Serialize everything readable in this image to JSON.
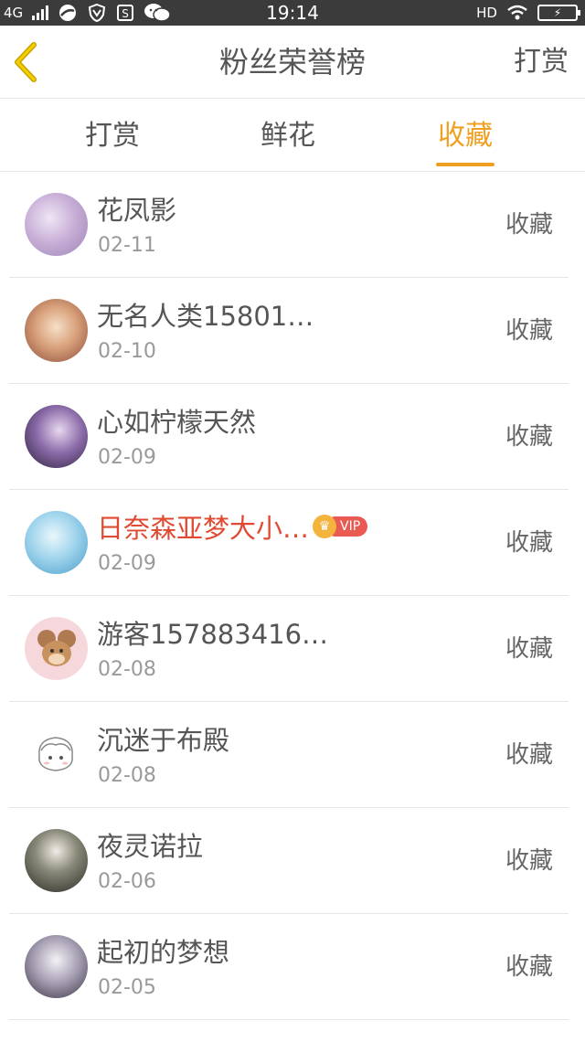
{
  "status_bar": {
    "network": "4G",
    "time": "19:14",
    "hd": "HD"
  },
  "nav": {
    "title": "粉丝荣誉榜",
    "action": "打赏"
  },
  "tabs": [
    {
      "label": "打赏",
      "active": false
    },
    {
      "label": "鲜花",
      "active": false
    },
    {
      "label": "收藏",
      "active": true
    }
  ],
  "colors": {
    "accent": "#f0a020",
    "vip_name": "#e04a32",
    "vip_badge": "#e85a52"
  },
  "list": [
    {
      "name": "花凤影",
      "date": "02-11",
      "action": "收藏",
      "vip": false
    },
    {
      "name": "无名人类15801…",
      "date": "02-10",
      "action": "收藏",
      "vip": false
    },
    {
      "name": "心如柠檬天然",
      "date": "02-09",
      "action": "收藏",
      "vip": false
    },
    {
      "name": "日奈森亚梦大小…",
      "date": "02-09",
      "action": "收藏",
      "vip": true,
      "badge": "VIP"
    },
    {
      "name": "游客157883416…",
      "date": "02-08",
      "action": "收藏",
      "vip": false
    },
    {
      "name": "沉迷于布殿",
      "date": "02-08",
      "action": "收藏",
      "vip": false
    },
    {
      "name": "夜灵诺拉",
      "date": "02-06",
      "action": "收藏",
      "vip": false
    },
    {
      "name": "起初的梦想",
      "date": "02-05",
      "action": "收藏",
      "vip": false
    }
  ]
}
